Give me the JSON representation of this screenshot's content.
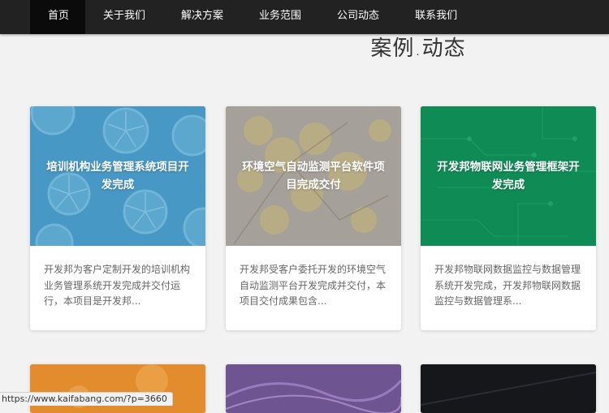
{
  "nav": {
    "items": [
      {
        "label": "首页",
        "active": true
      },
      {
        "label": "关于我们"
      },
      {
        "label": "解决方案"
      },
      {
        "label": "业务范围"
      },
      {
        "label": "公司动态"
      },
      {
        "label": "联系我们"
      }
    ]
  },
  "section": {
    "title": "案例.动态"
  },
  "cards": [
    {
      "title": "培训机构业务管理系统项目开发完成",
      "excerpt": "开发邦为客户定制开发的培训机构业务管理系统开发完成并交付运行，本项目是开发邦...",
      "color": "#4a9fc8"
    },
    {
      "title": "环境空气自动监测平台软件项目完成交付",
      "excerpt": "开发邦受客户委托开发的环境空气自动监测平台开发完成并交付，本项目交付成果包含...",
      "color": "#a8a298"
    },
    {
      "title": "开发邦物联网业务管理框架开发完成",
      "excerpt": "开发邦物联网数据监控与数据管理系统开发完成，开发邦物联网数据监控与数据管理系...",
      "color": "#14935c"
    }
  ],
  "status_bar": {
    "url": "https://www.kaifabang.com/?p=3660"
  }
}
